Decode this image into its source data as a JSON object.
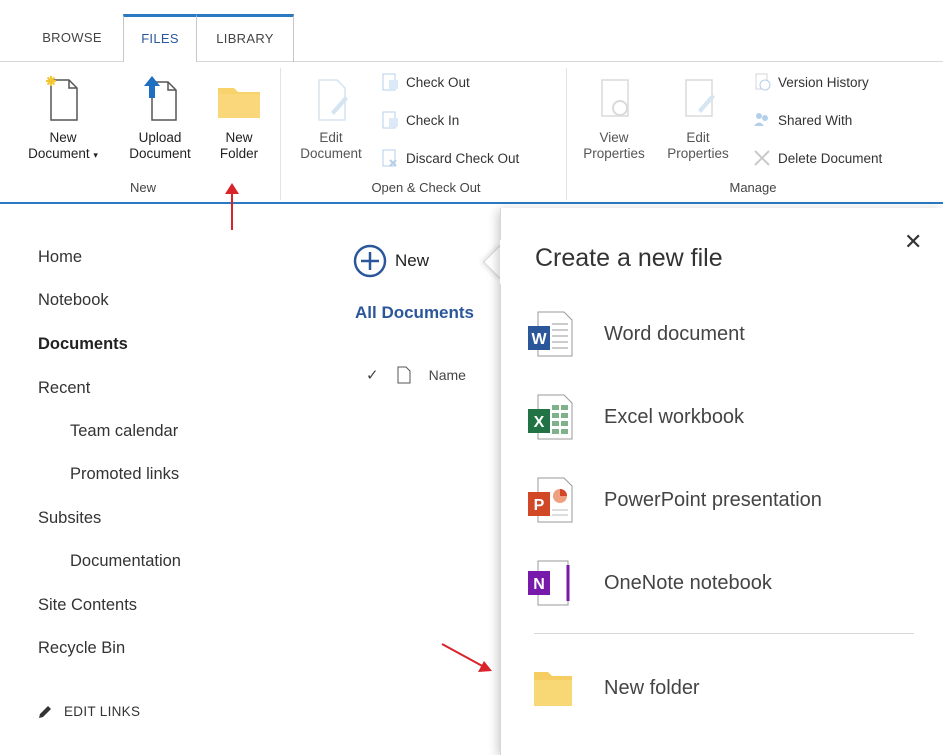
{
  "tabs": [
    {
      "label": "BROWSE"
    },
    {
      "label": "FILES"
    },
    {
      "label": "LIBRARY"
    }
  ],
  "ribbon": {
    "new_group": {
      "label": "New",
      "new_document_line1": "New",
      "new_document_line2": "Document",
      "upload_line1": "Upload",
      "upload_line2": "Document",
      "new_folder_line1": "New",
      "new_folder_line2": "Folder"
    },
    "open_group": {
      "label": "Open & Check Out",
      "edit_line1": "Edit",
      "edit_line2": "Document",
      "check_out": "Check Out",
      "check_in": "Check In",
      "discard": "Discard Check Out"
    },
    "manage_group": {
      "label": "Manage",
      "view_line1": "View",
      "view_line2": "Properties",
      "editp_line1": "Edit",
      "editp_line2": "Properties",
      "version_history": "Version History",
      "shared_with": "Shared With",
      "delete_document": "Delete Document"
    }
  },
  "leftnav": {
    "items": [
      {
        "label": "Home"
      },
      {
        "label": "Notebook"
      },
      {
        "label": "Documents"
      },
      {
        "label": "Recent"
      },
      {
        "label": "Team calendar"
      },
      {
        "label": "Promoted links"
      },
      {
        "label": "Subsites"
      },
      {
        "label": "Documentation"
      },
      {
        "label": "Site Contents"
      },
      {
        "label": "Recycle Bin"
      }
    ],
    "edit_links": "EDIT LINKS"
  },
  "main": {
    "new_label": "New",
    "view_name": "All Documents",
    "name_column": "Name"
  },
  "callout": {
    "title": "Create a new file",
    "close": "✕",
    "options": [
      {
        "label": "Word document",
        "icon": "word-icon",
        "letter": "W",
        "color": "#2b579a"
      },
      {
        "label": "Excel workbook",
        "icon": "excel-icon",
        "letter": "X",
        "color": "#217346"
      },
      {
        "label": "PowerPoint presentation",
        "icon": "powerpoint-icon",
        "letter": "P",
        "color": "#d24726"
      },
      {
        "label": "OneNote notebook",
        "icon": "onenote-icon",
        "letter": "N",
        "color": "#7719aa"
      }
    ],
    "new_folder": "New folder"
  },
  "colors": {
    "accent": "#2b79c2",
    "link": "#2b579a",
    "folder": "#f8d775",
    "arrow": "#d9222a"
  }
}
